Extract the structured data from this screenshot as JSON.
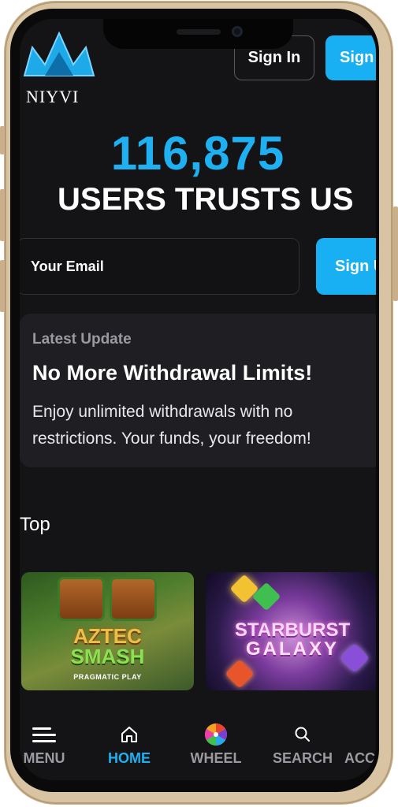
{
  "brand": {
    "name": "NIYVI",
    "accent": "#18b0f3"
  },
  "header": {
    "signin_label": "Sign In",
    "signup_label": "Sign Up"
  },
  "hero": {
    "count": "116,875",
    "tagline": "USERS TRUSTS US"
  },
  "signup_form": {
    "email_placeholder": "Your Email",
    "button_label": "Sign Up"
  },
  "update": {
    "kicker": "Latest Update",
    "title": "No More Withdrawal Limits!",
    "body": "Enjoy unlimited withdrawals with no restrictions. Your funds, your freedom!"
  },
  "section": {
    "title": "Top"
  },
  "games": [
    {
      "title_line1": "AZTEC",
      "title_line2": "SMASH",
      "provider": "PRAGMATIC PLAY"
    },
    {
      "title_line1": "STARBURST",
      "title_line2": "GALAXY"
    }
  ],
  "nav": [
    {
      "label": "MENU",
      "icon": "menu-icon",
      "active": false
    },
    {
      "label": "HOME",
      "icon": "home-icon",
      "active": true
    },
    {
      "label": "WHEEL",
      "icon": "wheel-icon",
      "active": false
    },
    {
      "label": "SEARCH",
      "icon": "search-icon",
      "active": false
    },
    {
      "label": "ACCOUNT",
      "icon": "account-icon",
      "active": false
    }
  ]
}
